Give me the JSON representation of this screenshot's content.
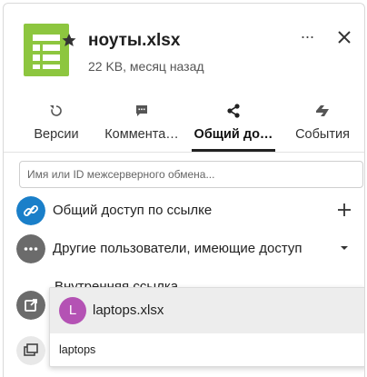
{
  "file": {
    "name": "ноуты.xlsx",
    "meta": "22 KB, месяц назад",
    "icon": "spreadsheet-icon",
    "favorite_icon": "star-icon"
  },
  "header": {
    "more_label": "···",
    "more_icon": "more-icon",
    "close_icon": "close-icon"
  },
  "tabs": [
    {
      "label": "Версии",
      "icon": "history-icon"
    },
    {
      "label": "Коммента…",
      "icon": "comment-icon"
    },
    {
      "label": "Общий до…",
      "icon": "share-icon",
      "active": true
    },
    {
      "label": "События",
      "icon": "activity-icon"
    }
  ],
  "share_input": {
    "placeholder": "Имя или ID межсерверного обмена..."
  },
  "rows": {
    "link": {
      "label": "Общий доступ по ссылке",
      "icon": "link-icon",
      "action_icon": "plus-icon"
    },
    "others": {
      "label": "Другие пользователи, имеющие доступ",
      "icon": "more-icon",
      "action_icon": "caret-down-icon"
    },
    "internal": {
      "label": "Внутренняя ссылка",
      "icon": "external-link-icon"
    },
    "copy": {
      "icon": "copy-icon"
    }
  },
  "dropdown": {
    "item_label": "laptops.xlsx",
    "avatar_letter": "L",
    "query": "laptops"
  },
  "colors": {
    "spreadsheet": "#8dc63f",
    "link_circle": "#1a7fc9",
    "grey_circle": "#6b6b6b",
    "avatar": "#b452b4"
  }
}
